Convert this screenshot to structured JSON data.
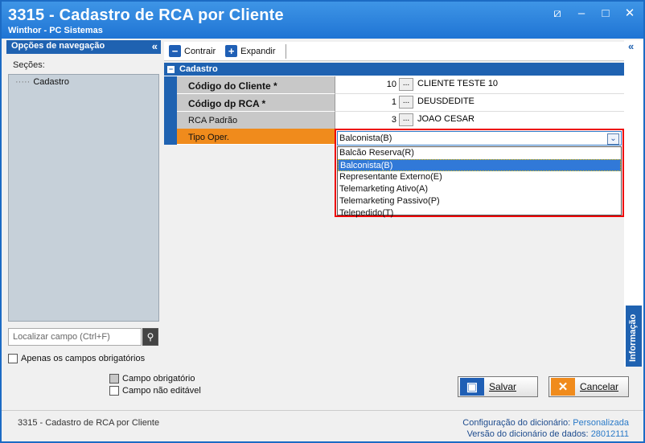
{
  "window": {
    "title": "3315 - Cadastro de RCA por Cliente",
    "subtitle": "Winthor - PC Sistemas",
    "controls": {
      "restore": "⧄",
      "minimize": "–",
      "maximize": "□",
      "close": "✕"
    }
  },
  "nav": {
    "header": "Opções de navegação",
    "collapse_icon": "«",
    "sections_label": "Seções:",
    "tree": [
      {
        "label": "Cadastro",
        "prefix": "·····"
      }
    ],
    "search_placeholder": "Localizar campo (Ctrl+F)",
    "only_required_label": "Apenas os campos obrigatórios",
    "legend_required": "Campo obrigatório",
    "legend_not_editable": "Campo não editável"
  },
  "toolbar": {
    "collapse_label": "Contrair",
    "expand_label": "Expandir",
    "collapse_icon": "−",
    "expand_icon": "+"
  },
  "grid": {
    "group_label": "Cadastro",
    "rows": [
      {
        "label": "Código do Cliente *",
        "number": "10",
        "button": "...",
        "description": "CLIENTE TESTE 10"
      },
      {
        "label": "Código dp RCA *",
        "number": "1",
        "button": "...",
        "description": "DEUSDEDITE"
      },
      {
        "label": "RCA Padrão",
        "number": "3",
        "button": "...",
        "description": "JOAO CESAR"
      },
      {
        "label": "Tipo Oper."
      }
    ]
  },
  "dropdown": {
    "selected": "Balconista(B)",
    "arrow": "⌄",
    "options": [
      "Balcão Reserva(R)",
      "Balconista(B)",
      "Representante Externo(E)",
      "Telemarketing Ativo(A)",
      "Telemarketing Passivo(P)",
      "Telepedido(T)"
    ],
    "active_index": 1
  },
  "info_panel": {
    "label": "Informação",
    "collapse_icon": "«"
  },
  "buttons": {
    "save_label": "Salvar",
    "cancel_label": "Cancelar",
    "save_icon": "floppy-icon",
    "cancel_icon": "x-icon"
  },
  "footer": {
    "left": "3315 - Cadastro de RCA por Cliente",
    "config_label": "Configuração do dicionário:",
    "config_value": "Personalizada",
    "version_label": "Versão do dicionário de dados:",
    "version_value": "28012111"
  },
  "colors": {
    "title_bar": "#1f74d4",
    "header_blue": "#1f62b1",
    "selected_row": "#f08b1c",
    "highlight_border": "#ee0000"
  }
}
